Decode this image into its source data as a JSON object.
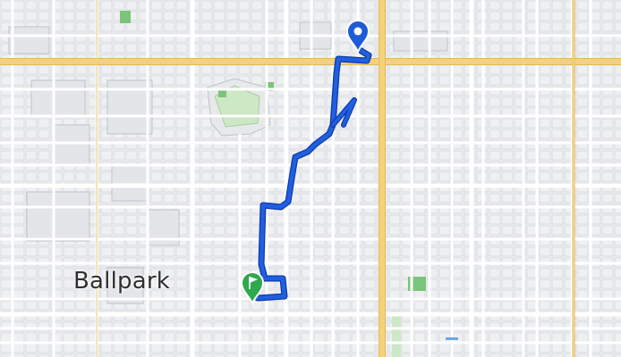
{
  "map": {
    "place_label": "Ballpark",
    "colors": {
      "background": "#eef0f2",
      "minor_street": "#ffffff",
      "arterial": "#f3d27a",
      "arterial_edge": "#e3b95a",
      "block_outline": "#c9ccd2",
      "park": "#cde8c4",
      "park_dark": "#7cc47a",
      "route": "#1f5fe0",
      "route_casing": "#0f3aa8",
      "start_marker": "#1e5bd8",
      "end_marker": "#2fa84f"
    },
    "route": {
      "start_marker_icon": "map-pin-icon",
      "end_marker_icon": "finish-flag-icon"
    }
  }
}
